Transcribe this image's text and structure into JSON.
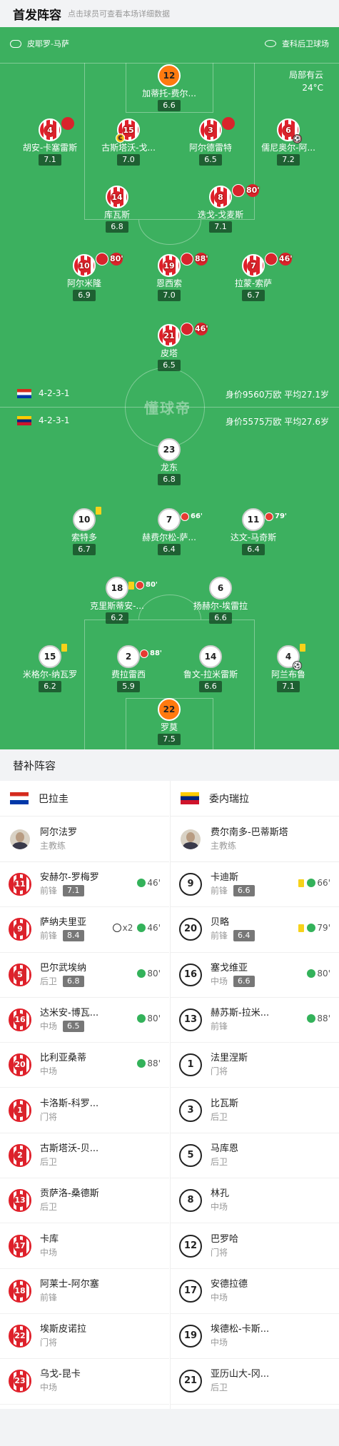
{
  "header": {
    "title": "首发阵容",
    "subtitle": "点击球员可查看本场详细数据"
  },
  "match": {
    "referee": "皮耶罗-马萨",
    "venue": "查科后卫球场",
    "weather": "局部有云",
    "temperature": "24°C",
    "watermark": "懂球帝"
  },
  "home": {
    "formation": "4-2-3-1",
    "value": "身价9560万欧 平均27.1岁"
  },
  "away": {
    "formation": "4-2-3-1",
    "value": "身价5575万欧 平均27.6岁"
  },
  "home_players": [
    {
      "num": "12",
      "name": "加蒂托-费尔...",
      "rating": "6.6"
    },
    {
      "num": "4",
      "name": "胡安-卡塞雷斯",
      "rating": "7.1",
      "event": ""
    },
    {
      "num": "15",
      "name": "古斯塔沃-戈...",
      "rating": "7.0"
    },
    {
      "num": "3",
      "name": "阿尔德雷特",
      "rating": "6.5"
    },
    {
      "num": "6",
      "name": "儒尼奥尔-阿...",
      "rating": "7.2"
    },
    {
      "num": "14",
      "name": "库瓦斯",
      "rating": "6.8"
    },
    {
      "num": "8",
      "name": "迭戈-戈麦斯",
      "rating": "7.1",
      "event": "80'"
    },
    {
      "num": "10",
      "name": "阿尔米隆",
      "rating": "6.9",
      "event": "80'"
    },
    {
      "num": "19",
      "name": "恩西索",
      "rating": "7.0",
      "event": "88'"
    },
    {
      "num": "7",
      "name": "拉蒙-索萨",
      "rating": "6.7",
      "event": "46'"
    },
    {
      "num": "21",
      "name": "皮塔",
      "rating": "6.5",
      "event": "46'"
    }
  ],
  "away_players": [
    {
      "num": "23",
      "name": "龙东",
      "rating": "6.8"
    },
    {
      "num": "10",
      "name": "索特多",
      "rating": "6.7"
    },
    {
      "num": "7",
      "name": "赫费尔松-萨...",
      "rating": "6.4",
      "event": "66'"
    },
    {
      "num": "11",
      "name": "达文-马奇斯",
      "rating": "6.4",
      "event": "79'"
    },
    {
      "num": "18",
      "name": "克里斯蒂安-...",
      "rating": "6.2",
      "event": "80'"
    },
    {
      "num": "6",
      "name": "扬赫尔-埃雷拉",
      "rating": "6.6"
    },
    {
      "num": "15",
      "name": "米格尔-纳瓦罗",
      "rating": "6.2"
    },
    {
      "num": "2",
      "name": "费拉雷西",
      "rating": "5.9",
      "event": "88'"
    },
    {
      "num": "14",
      "name": "鲁文-拉米雷斯",
      "rating": "6.6"
    },
    {
      "num": "4",
      "name": "阿兰布鲁",
      "rating": "7.1"
    },
    {
      "num": "22",
      "name": "罗莫",
      "rating": "7.5"
    }
  ],
  "subs_title": "替补阵容",
  "home_team": "巴拉圭",
  "away_team": "委内瑞拉",
  "home_coach": {
    "name": "阿尔法罗",
    "role": "主教练"
  },
  "away_coach": {
    "name": "费尔南多-巴蒂斯塔",
    "role": "主教练"
  },
  "home_subs": [
    {
      "num": "11",
      "name": "安赫尔-罗梅罗",
      "pos": "前锋",
      "rating": "7.1",
      "event": "46'"
    },
    {
      "num": "9",
      "name": "萨纳夫里亚",
      "pos": "前锋",
      "rating": "8.4",
      "goals": "x2",
      "event": "46'"
    },
    {
      "num": "5",
      "name": "巴尔武埃纳",
      "pos": "后卫",
      "rating": "6.8",
      "event": "80'"
    },
    {
      "num": "16",
      "name": "达米安-博瓦...",
      "pos": "中场",
      "rating": "6.5",
      "event": "80'"
    },
    {
      "num": "20",
      "name": "比利亚桑蒂",
      "pos": "中场",
      "event": "88'"
    },
    {
      "num": "1",
      "name": "卡洛斯-科罗...",
      "pos": "门将"
    },
    {
      "num": "2",
      "name": "古斯塔沃-贝...",
      "pos": "后卫"
    },
    {
      "num": "13",
      "name": "贡萨洛-桑德斯",
      "pos": "后卫"
    },
    {
      "num": "17",
      "name": "卡库",
      "pos": "中场"
    },
    {
      "num": "18",
      "name": "阿莱士-阿尔塞",
      "pos": "前锋"
    },
    {
      "num": "22",
      "name": "埃斯皮诺拉",
      "pos": "门将"
    },
    {
      "num": "23",
      "name": "乌戈-昆卡",
      "pos": "中场"
    }
  ],
  "away_subs": [
    {
      "num": "9",
      "name": "卡迪斯",
      "pos": "前锋",
      "rating": "6.6",
      "event": "66'"
    },
    {
      "num": "20",
      "name": "贝略",
      "pos": "前锋",
      "rating": "6.4",
      "event": "79'"
    },
    {
      "num": "16",
      "name": "塞戈维亚",
      "pos": "中场",
      "rating": "6.6",
      "event": "80'"
    },
    {
      "num": "13",
      "name": "赫苏斯-拉米...",
      "pos": "前锋",
      "event": "88'"
    },
    {
      "num": "1",
      "name": "法里涅斯",
      "pos": "门将"
    },
    {
      "num": "3",
      "name": "比瓦斯",
      "pos": "后卫"
    },
    {
      "num": "5",
      "name": "马库恩",
      "pos": "后卫"
    },
    {
      "num": "8",
      "name": "林孔",
      "pos": "中场"
    },
    {
      "num": "12",
      "name": "巴罗哈",
      "pos": "门将"
    },
    {
      "num": "17",
      "name": "安德拉德",
      "pos": "中场"
    },
    {
      "num": "19",
      "name": "埃德松-卡斯...",
      "pos": "中场"
    },
    {
      "num": "21",
      "name": "亚历山大-冈...",
      "pos": "后卫"
    }
  ]
}
